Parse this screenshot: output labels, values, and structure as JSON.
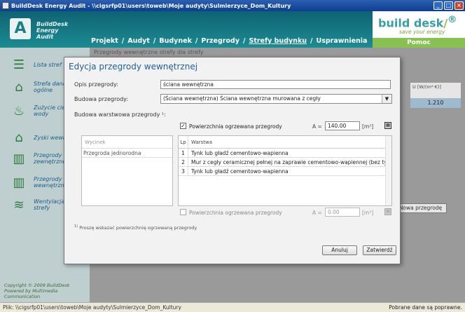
{
  "window": {
    "title": "BuildDesk Energy Audit - \\\\cigsrfp01\\users\\toweb\\Moje audyty\\Sulmierzyce_Dom_Kultury"
  },
  "header": {
    "logo_text": [
      "BuildDesk",
      "Energy",
      "Audit"
    ],
    "logo_letter": "A",
    "nav": [
      "Projekt",
      "Audyt",
      "Budynek",
      "Przegrody",
      "Strefy budynku",
      "Usprawnienia"
    ],
    "nav_sep": "/",
    "active_nav": "Strefy budynku",
    "brand": "build desk",
    "brand_slash": "/",
    "brand_mark": "®",
    "tagline": "save your energy",
    "help": "Pomoc"
  },
  "sidebar": {
    "items": [
      {
        "label": "Lista stref",
        "icon": "list-icon"
      },
      {
        "label": "Strefa dane ogólne",
        "icon": "house-icon"
      },
      {
        "label": "Zużycie ciepłej wody użytkowej",
        "icon": "water-icon"
      },
      {
        "label": "Zyski wewnętrzne",
        "icon": "gains-icon"
      },
      {
        "label": "Przegrody zewnętrzne",
        "icon": "wall-icon"
      },
      {
        "label": "Przegrody wewnętrzne",
        "icon": "inner-wall-icon"
      },
      {
        "label": "Wentylacja strefy",
        "icon": "ventilation-icon"
      }
    ],
    "copyright": [
      "Copyright © 2009 BuildDesk",
      "Powered by Multimedia Communication"
    ]
  },
  "background": {
    "row_text": "Przegrody wewnętrzne strefy dla strefy",
    "u_header": "U [W/(m²·K)]",
    "u_value": "1.210",
    "new_partition_button": "Nowa przegrodę"
  },
  "dialog": {
    "title": "Edycja przegrody wewnętrznej",
    "description_label": "Opis przegrody:",
    "description_value": "ściana wewnętrzna",
    "construction_label": "Budowa przegrody:",
    "construction_value": "(Ściana wewnętrzna) Ściana wewnętrzna murowana z cegły",
    "layers_label": "Budowa warstwowa przegrody ¹:",
    "heated_area_1": {
      "label": "Powierzchnia ogrzewana przegrody",
      "checked": true,
      "a_label": "A =",
      "value": "140.00",
      "unit": "[m²]"
    },
    "heated_area_2": {
      "label": "Powierzchnia ogrzewana przegrody",
      "checked": false,
      "a_label": "A =",
      "value": "0.00",
      "unit": "[m²]"
    },
    "variant_header": "Wycinek",
    "variants": [
      "Przegroda jednorodna"
    ],
    "layer_headers": [
      "Lp",
      "Warstwa"
    ],
    "layers": [
      {
        "lp": "1",
        "name": "Tynk lub gładź cementowo-wapienna"
      },
      {
        "lp": "2",
        "name": "Mur z cegły ceramicznej pełnej na zaprawie cementowo-wapiennej (bez tynku)"
      },
      {
        "lp": "3",
        "name": "Tynk lub gładź cementowo-wapienna"
      }
    ],
    "footnote": "Proszę wskazać powierzchnię ogrzewaną przegrody",
    "footnote_mark": "1)",
    "cancel": "Anuluj",
    "confirm": "Zatwierdź"
  },
  "status": {
    "path": "Plik:  \\\\cigsrfp01\\users\\toweb\\Moje audyty\\Sulmierzyce_Dom_Kultury",
    "message": "Pobrane dane są poprawne."
  },
  "colors": {
    "header": "#0f6472",
    "accent": "#1e5f9c",
    "help": "#88c152",
    "sidebar": "#bfcfd0"
  }
}
